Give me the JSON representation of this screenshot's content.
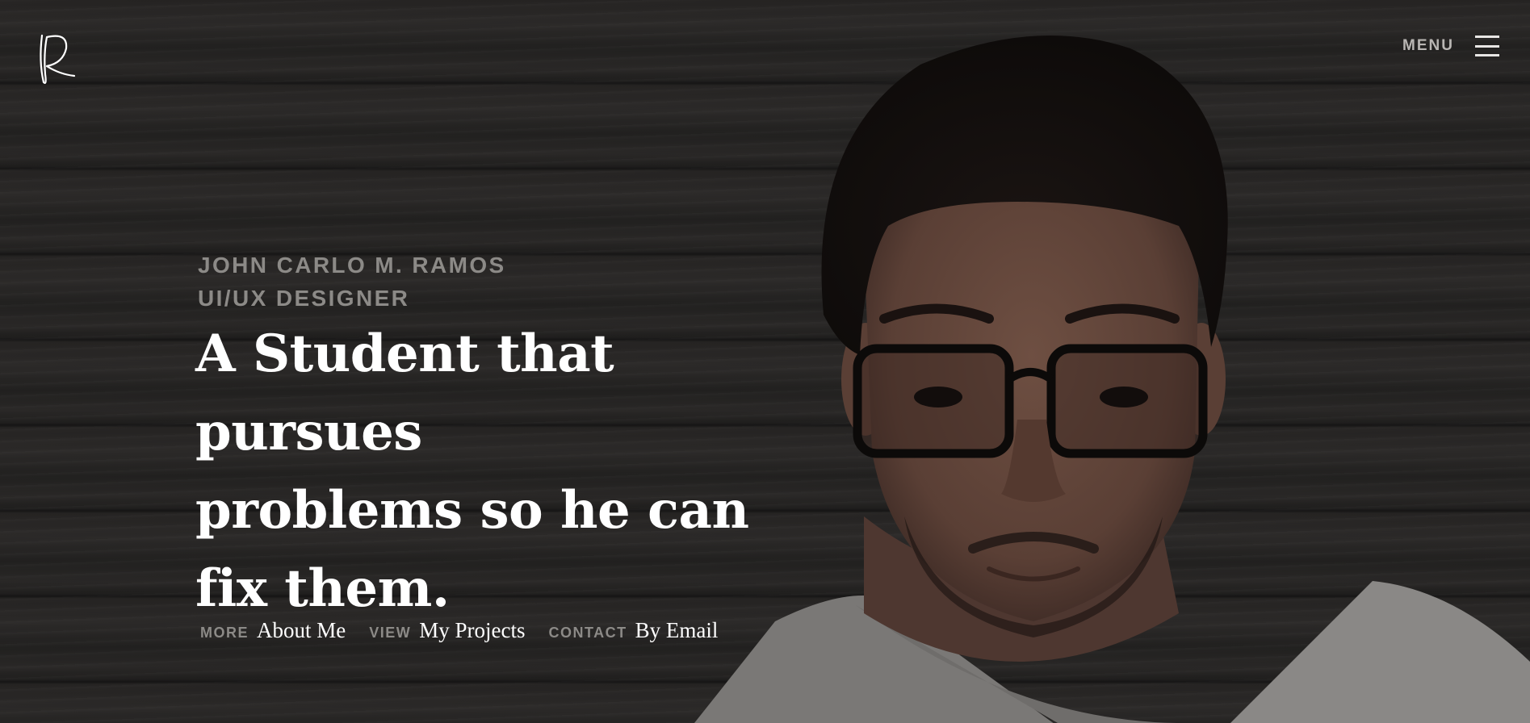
{
  "header": {
    "logo_icon": "r-signature-logo-icon",
    "menu_label": "MENU",
    "menu_icon": "hamburger-icon"
  },
  "hero": {
    "name": "JOHN CARLO M. RAMOS",
    "role": "UI/UX DESIGNER",
    "headline_lines": [
      "A Student that pursues",
      "problems so he can",
      "fix them."
    ]
  },
  "links": [
    {
      "kicker": "MORE",
      "label": "About Me"
    },
    {
      "kicker": "VIEW",
      "label": "My Projects"
    },
    {
      "kicker": "CONTACT",
      "label": "By Email"
    }
  ],
  "colors": {
    "background": "#252322",
    "accent_text": "#8c8a87",
    "primary_text": "#ffffff"
  }
}
